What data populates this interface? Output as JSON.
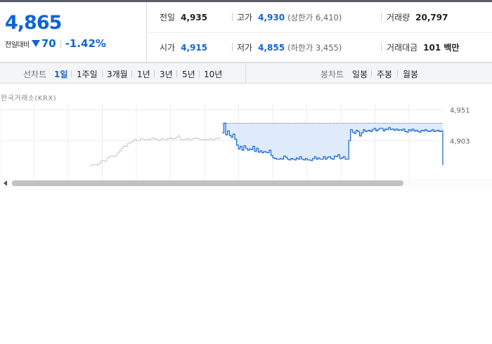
{
  "summary": {
    "price": "4,865",
    "change_label": "전일대비",
    "change_amount": "70",
    "change_percent": "-1.42%",
    "prev_close_label": "전일",
    "prev_close": "4,935",
    "high_label": "고가",
    "high": "4,930",
    "upper_limit": "(상한가 6,410)",
    "volume_label": "거래량",
    "volume": "20,797",
    "open_label": "시가",
    "open": "4,915",
    "low_label": "저가",
    "low": "4,855",
    "lower_limit": "(하한가 3,455)",
    "amount_label": "거래대금",
    "amount": "101 백만"
  },
  "period": {
    "line_label": "선차트",
    "line_items": [
      "1일",
      "1주일",
      "3개월",
      "1년",
      "3년",
      "5년",
      "10년"
    ],
    "active": "1일",
    "candle_label": "봉차트",
    "candle_items": [
      "일봉",
      "주봉",
      "월봉"
    ]
  },
  "source": "한국거래소(KRX)",
  "colors": {
    "accent": "#1064d4",
    "fill": "#dce9f9",
    "prev_line": "#c8c8c8"
  },
  "chart_data": {
    "type": "line",
    "y_ticks": [
      "4,951",
      "4,903"
    ],
    "ylim": [
      4840,
      4960
    ],
    "grid": true,
    "series": [
      {
        "values": [
          4864,
          4866,
          4866,
          4865,
          4867,
          4871,
          4872,
          4871,
          4876,
          4878,
          4879,
          4878,
          4880,
          4884,
          4887,
          4891,
          4895,
          4894,
          4899,
          4900,
          4902,
          4905,
          4903,
          4903,
          4906,
          4905,
          4904,
          4905,
          4904,
          4906,
          4907,
          4905,
          4904,
          4904,
          4906,
          4905,
          4904,
          4906,
          4907,
          4905,
          4906,
          4908,
          4910,
          4905,
          4904,
          4905,
          4906,
          4904,
          4905,
          4906,
          4907,
          4906,
          4905,
          4904,
          4905,
          4904,
          4905,
          4906,
          4904,
          4905,
          4906,
          4907,
          4908
        ]
      },
      {
        "values": [
          4915,
          4930,
          4912,
          4918,
          4911,
          4908,
          4913,
          4905,
          4896,
          4890,
          4894,
          4888,
          4895,
          4891,
          4888,
          4890,
          4889,
          4894,
          4886,
          4891,
          4885,
          4887,
          4884,
          4886,
          4885,
          4884,
          4888,
          4880,
          4876,
          4875,
          4874,
          4874,
          4875,
          4874,
          4879,
          4877,
          4874,
          4873,
          4875,
          4874,
          4873,
          4876,
          4874,
          4878,
          4874,
          4873,
          4875,
          4873,
          4873,
          4872,
          4875,
          4878,
          4874,
          4876,
          4874,
          4874,
          4878,
          4874,
          4877,
          4878,
          4875,
          4874,
          4879,
          4878,
          4881,
          4875,
          4876,
          4878,
          4874,
          4874,
          4903,
          4920,
          4916,
          4914,
          4919,
          4917,
          4910,
          4915,
          4920,
          4917,
          4918,
          4919,
          4917,
          4920,
          4922,
          4918,
          4920,
          4922,
          4922,
          4918,
          4921,
          4920,
          4923,
          4920,
          4921,
          4919,
          4921,
          4919,
          4920,
          4919,
          4921,
          4917,
          4916,
          4920,
          4918,
          4921,
          4918,
          4919,
          4917,
          4916,
          4919,
          4918,
          4920,
          4918,
          4917,
          4918,
          4920,
          4917,
          4918,
          4919,
          4917,
          4918,
          4865
        ]
      }
    ]
  }
}
